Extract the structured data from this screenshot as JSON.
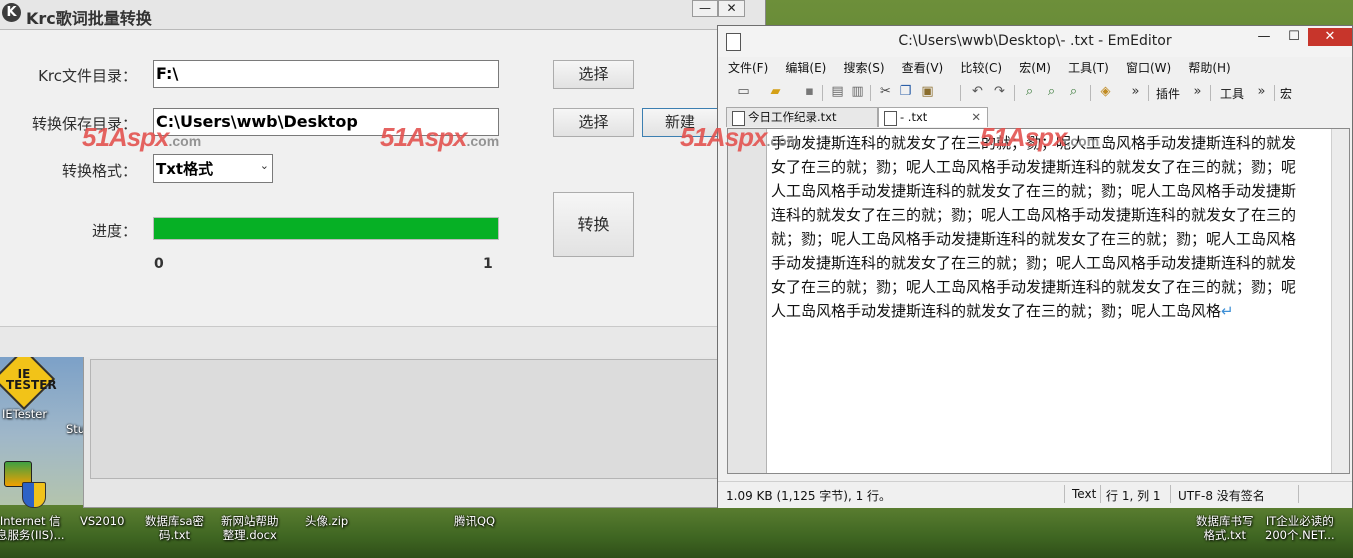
{
  "krc_window": {
    "title": "Krc歌词批量转换",
    "logo_letter": "K",
    "minimize": "—",
    "close": "✕",
    "krc_dir_label": "Krc文件目录：",
    "krc_dir_value": "F:\\",
    "save_dir_label": "转换保存目录：",
    "save_dir_value": "C:\\Users\\wwb\\Desktop",
    "format_label": "转换格式：",
    "format_selected": "Txt格式",
    "progress_label": "进度：",
    "progress_min": "0",
    "progress_max": "1",
    "progress_fraction": 1.0,
    "choose_btn_1": "选择",
    "choose_btn_2": "选择",
    "new_btn": "新建",
    "convert_btn": "转换"
  },
  "watermark": {
    "brand": "51Aspx",
    "suffix": ".com"
  },
  "em_window": {
    "title": "C:\\Users\\wwb\\Desktop\\- .txt - EmEditor",
    "minimize": "—",
    "maximize": "☐",
    "close": "✕",
    "menu": [
      "文件(F)",
      "编辑(E)",
      "搜索(S)",
      "查看(V)",
      "比较(C)",
      "宏(M)",
      "工具(T)",
      "窗口(W)",
      "帮助(H)"
    ],
    "toolbar_labels": [
      "插件",
      "工具",
      "宏"
    ],
    "tabs": [
      {
        "label": "今日工作纪录.txt"
      },
      {
        "label": "- .txt",
        "close": "✕"
      }
    ],
    "content": "手动发捷斯连科的就发女了在三的就；勠；呢人工岛风格手动发捷斯连科的就发女了在三的就；勠；呢人工岛风格手动发捷斯连科的就发女了在三的就；勠；呢人工岛风格手动发捷斯连科的就发女了在三的就；勠；呢人工岛风格手动发捷斯连科的就发女了在三的就；勠；呢人工岛风格手动发捷斯连科的就发女了在三的就；勠；呢人工岛风格手动发捷斯连科的就发女了在三的就；勠；呢人工岛风格手动发捷斯连科的就发女了在三的就；勠；呢人工岛风格手动发捷斯连科的就发女了在三的就；勠；呢人工岛风格手动发捷斯连科的就发女了在三的就；勠；呢人工岛风格手动发捷斯连科的就发女了在三的就；勠；呢人工岛风格",
    "eol_mark": "↵",
    "status": {
      "size": "1.09 KB (1,125 字节), 1 行。",
      "mode": "Text",
      "position": "行 1, 列 1",
      "encoding": "UTF-8 没有签名"
    }
  },
  "desktop": {
    "ie_badge": "IE\nTESTER",
    "icons": [
      {
        "label": "IETester"
      },
      {
        "label": "Stu"
      },
      {
        "label": "Internet 信\n息服务(IIS)..."
      },
      {
        "label": "VS2010"
      },
      {
        "label": "数据库sa密\n码.txt"
      },
      {
        "label": "新网站帮助\n整理.docx"
      },
      {
        "label": "头像.zip"
      },
      {
        "label": "腾讯QQ"
      },
      {
        "label": "数据库书写\n格式.txt"
      },
      {
        "label": "IT企业必读的\n200个.NET..."
      }
    ]
  }
}
